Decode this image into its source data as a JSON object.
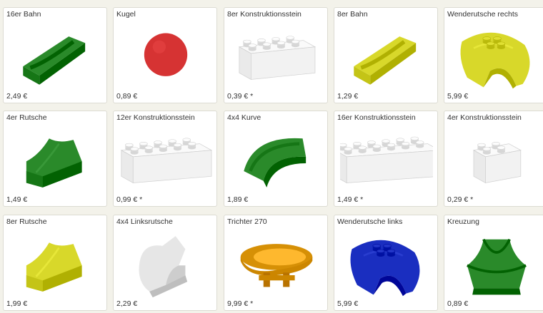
{
  "products": [
    {
      "title": "16er Bahn",
      "price": "2,49 €",
      "icon": "track-16-icon",
      "color": "#2a8a2a"
    },
    {
      "title": "Kugel",
      "price": "0,89 €",
      "icon": "ball-icon",
      "color": "#d63333"
    },
    {
      "title": "8er Konstruktionsstein",
      "price": "0,39 € *",
      "icon": "brick-8-icon",
      "color": "#f4f4f4"
    },
    {
      "title": "8er Bahn",
      "price": "1,29 €",
      "icon": "track-8-icon",
      "color": "#d8d82a"
    },
    {
      "title": "Wenderutsche rechts",
      "price": "5,99 €",
      "icon": "turn-slide-right-icon",
      "color": "#d8d82a"
    },
    {
      "title": "4er Rutsche",
      "price": "1,49 €",
      "icon": "slide-4-icon",
      "color": "#2a8a2a"
    },
    {
      "title": "12er Konstruktionsstein",
      "price": "0,99 € *",
      "icon": "brick-12-icon",
      "color": "#f4f4f4"
    },
    {
      "title": "4x4 Kurve",
      "price": "1,89 €",
      "icon": "curve-4x4-icon",
      "color": "#2a8a2a"
    },
    {
      "title": "16er Konstruktionsstein",
      "price": "1,49 € *",
      "icon": "brick-16-icon",
      "color": "#f4f4f4"
    },
    {
      "title": "4er Konstruktionsstein",
      "price": "0,29 € *",
      "icon": "brick-4-icon",
      "color": "#f4f4f4"
    },
    {
      "title": "8er Rutsche",
      "price": "1,99 €",
      "icon": "slide-8-icon",
      "color": "#d8d82a"
    },
    {
      "title": "4x4 Linksrutsche",
      "price": "2,29 €",
      "icon": "left-slide-icon",
      "color": "#e6e6e6"
    },
    {
      "title": "Trichter 270",
      "price": "9,99 € *",
      "icon": "funnel-icon",
      "color": "#e09a10"
    },
    {
      "title": "Wenderutsche links",
      "price": "5,99 €",
      "icon": "turn-slide-left-icon",
      "color": "#1a2ec0"
    },
    {
      "title": "Kreuzung",
      "price": "0,89 €",
      "icon": "crossing-icon",
      "color": "#2a8a2a"
    }
  ]
}
